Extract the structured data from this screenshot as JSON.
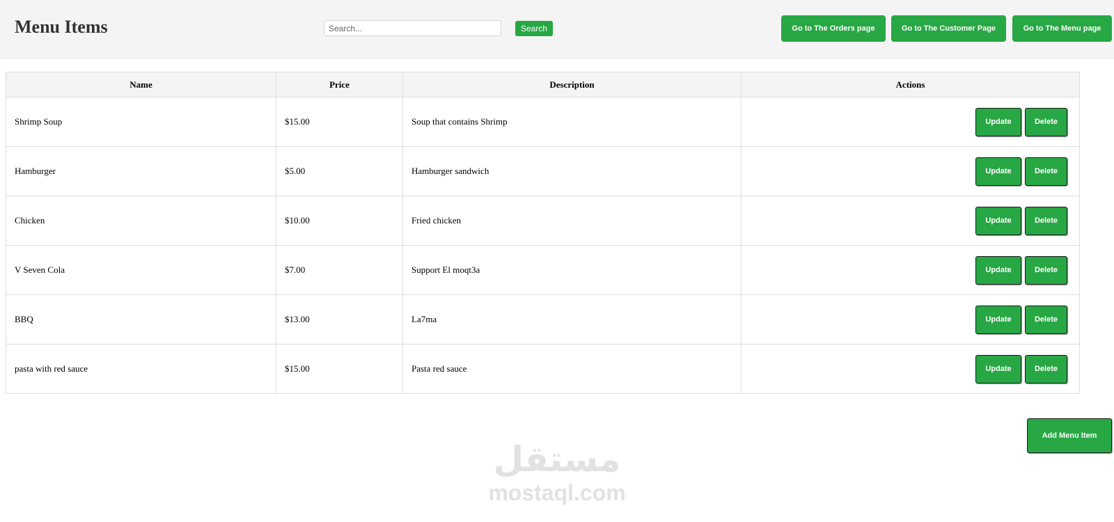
{
  "header": {
    "title": "Menu Items",
    "search_placeholder": "Search...",
    "search_value": "",
    "search_label": "Search",
    "nav": [
      {
        "label": "Go to The Orders page"
      },
      {
        "label": "Go to The Customer Page"
      },
      {
        "label": "Go to The Menu page"
      }
    ]
  },
  "table": {
    "columns": [
      "Name",
      "Price",
      "Description",
      "Actions"
    ],
    "rows": [
      {
        "name": "Shrimp Soup",
        "price": "$15.00",
        "description": "Soup that contains Shrimp"
      },
      {
        "name": "Hamburger",
        "price": "$5.00",
        "description": "Hamburger sandwich"
      },
      {
        "name": "Chicken",
        "price": "$10.00",
        "description": "Fried chicken"
      },
      {
        "name": "V Seven Cola",
        "price": "$7.00",
        "description": "Support El moqt3a"
      },
      {
        "name": "BBQ",
        "price": "$13.00",
        "description": "La7ma"
      },
      {
        "name": "pasta with red sauce",
        "price": "$15.00",
        "description": "Pasta red sauce"
      }
    ],
    "update_label": "Update",
    "delete_label": "Delete"
  },
  "add_label": "Add Menu Item",
  "watermark": {
    "logo_text": "مستقل",
    "text": "mostaql.com"
  },
  "colors": {
    "accent": "#28a745",
    "header_bg": "#f4f4f4",
    "border": "#dddddd"
  }
}
